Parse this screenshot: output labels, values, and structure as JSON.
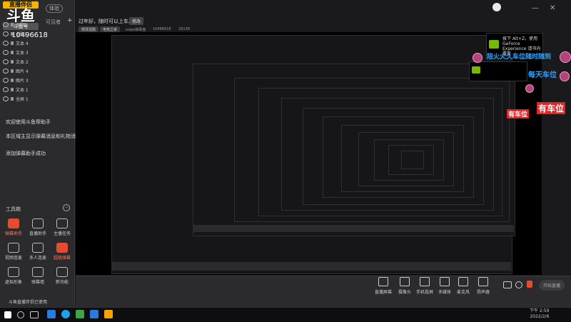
{
  "app": {
    "logo_line1": "直播伴侣",
    "logo_big": "斗鱼",
    "logo_tag": "斗鱼号",
    "room_id": "10496618",
    "badge": "体验",
    "scene_label": "可见者",
    "add_icon": "plus-icon"
  },
  "sources": [
    {
      "label": "主题1"
    },
    {
      "label": "主题1"
    },
    {
      "label": "文本 4"
    },
    {
      "label": "文本 3"
    },
    {
      "label": "文本 2"
    },
    {
      "label": "图片 4"
    },
    {
      "label": "图片 3"
    },
    {
      "label": "文本 1"
    },
    {
      "label": "全屏 1"
    }
  ],
  "tips": [
    "欢迎使用斗鱼帮助手",
    "本区域主显示弹幕消息和礼物消息",
    "添加弹幕助手成功"
  ],
  "tools": {
    "label": "工具箱",
    "toggle": "−",
    "items": [
      {
        "label": "弹幕助手",
        "active": true
      },
      {
        "label": "直播助手",
        "active": false
      },
      {
        "label": "主播任务",
        "active": false
      },
      {
        "label": "视频连麦",
        "active": false
      },
      {
        "label": "多人连麦",
        "active": false
      },
      {
        "label": "超级弹幕",
        "active": true
      },
      {
        "label": "虚拟形象",
        "active": false
      },
      {
        "label": "弹幕墙",
        "active": false
      },
      {
        "label": "新功能",
        "active": false
      }
    ]
  },
  "header": {
    "text": "过年好，随时可以上车。",
    "edit": "修改",
    "chips": [
      "修改话题",
      "电竞之家"
    ],
    "meta": [
      "snipe弹幕盘",
      "10496618",
      "29138"
    ]
  },
  "overlay": {
    "gf_title": "按下 Alt+Z。使用 GeForce Experience 请书内覆盖",
    "car1": "陪火火久车位随时随到",
    "car2": "每天车位",
    "car3": "有车位"
  },
  "bottom": {
    "buttons": [
      {
        "label": "直播屏幕"
      },
      {
        "label": "摄像头"
      },
      {
        "label": "手机投屏"
      },
      {
        "label": "多媒体"
      },
      {
        "label": "麦克风"
      },
      {
        "label": "扬声器"
      }
    ],
    "start_live": "开始直播",
    "notice": "斗鱼直播伴侣已使用"
  },
  "taskbar": {
    "time": "下午 2:59",
    "date": "2022/2/6"
  }
}
